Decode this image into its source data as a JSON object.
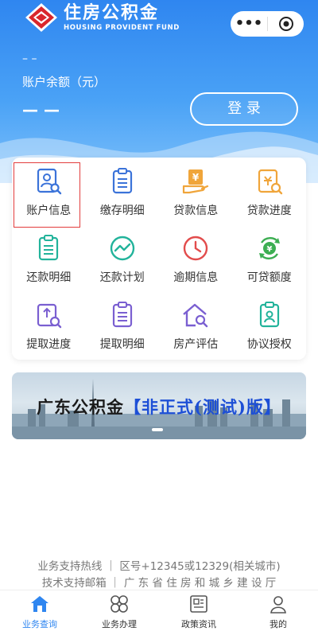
{
  "header": {
    "logo_title": "住房公积金",
    "logo_subtitle": "HOUSING PROVIDENT FUND",
    "capsule_more": "•••",
    "dash_top": "– –",
    "balance_label": "账户余额（元）",
    "balance_value": "— —",
    "login_label": "登 录"
  },
  "menu": {
    "items": [
      {
        "label": "账户信息",
        "icon": "account-search-icon",
        "color": "#3b73d9"
      },
      {
        "label": "缴存明细",
        "icon": "document-list-icon",
        "color": "#3b73d9"
      },
      {
        "label": "贷款信息",
        "icon": "loan-yen-icon",
        "color": "#f0a53a"
      },
      {
        "label": "贷款进度",
        "icon": "loan-progress-icon",
        "color": "#f0a53a"
      },
      {
        "label": "还款明细",
        "icon": "clipboard-list-icon",
        "color": "#22b39b"
      },
      {
        "label": "还款计划",
        "icon": "trend-circle-icon",
        "color": "#22b39b"
      },
      {
        "label": "逾期信息",
        "icon": "clock-icon",
        "color": "#e24c4c"
      },
      {
        "label": "可贷额度",
        "icon": "yen-cycle-icon",
        "color": "#3cae52"
      },
      {
        "label": "提取进度",
        "icon": "withdraw-progress-icon",
        "color": "#7a5fd1"
      },
      {
        "label": "提取明细",
        "icon": "withdraw-list-icon",
        "color": "#7a5fd1"
      },
      {
        "label": "房产评估",
        "icon": "house-search-icon",
        "color": "#7a5fd1"
      },
      {
        "label": "协议授权",
        "icon": "agreement-icon",
        "color": "#22b39b"
      }
    ]
  },
  "banner": {
    "title_prefix": "广东公积金",
    "title_highlight": "【非正式(测试)版】"
  },
  "footer": {
    "line1": "业务支持热线 ｜   区号+12345或12329(相关城市)",
    "line2": "技术支持邮箱 ｜ 广 东 省 住 房 和 城 乡 建 设 厅"
  },
  "tabbar": {
    "tabs": [
      {
        "label": "业务查询",
        "icon": "home-icon",
        "active": true
      },
      {
        "label": "业务办理",
        "icon": "grid-clover-icon",
        "active": false
      },
      {
        "label": "政策资讯",
        "icon": "news-icon",
        "active": false
      },
      {
        "label": "我的",
        "icon": "user-icon",
        "active": false
      }
    ],
    "active_color": "#2f86f0"
  }
}
